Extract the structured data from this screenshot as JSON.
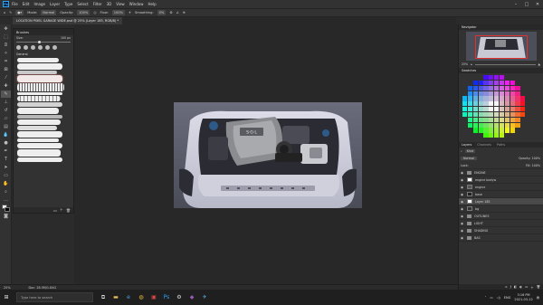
{
  "app": {
    "logo": "Ps",
    "menu": [
      "File",
      "Edit",
      "Image",
      "Layer",
      "Type",
      "Select",
      "Filter",
      "3D",
      "View",
      "Window",
      "Help"
    ],
    "window_controls": [
      "minimize-icon",
      "maximize-icon",
      "close-icon"
    ]
  },
  "options_bar": {
    "mode_label": "Mode:",
    "mode_value": "Normal",
    "opacity_label": "Opacity:",
    "opacity_value": "100%",
    "flow_label": "Flow:",
    "flow_value": "100%",
    "smoothing_label": "Smoothing:",
    "smoothing_value": "0%"
  },
  "document": {
    "tab_title": "LOCATION PIXEL GARAGE WIDE.psd @ 25% (Layer 185, RGB/8) *"
  },
  "tools": [
    "move",
    "marquee",
    "lasso",
    "quick-select",
    "crop",
    "frame",
    "eyedropper",
    "heal",
    "brush",
    "stamp",
    "history",
    "eraser",
    "gradient",
    "blur",
    "dodge",
    "pen",
    "type",
    "path-select",
    "rectangle",
    "hand",
    "zoom",
    "more",
    "color",
    "mask"
  ],
  "brushes_panel": {
    "title": "Brushes",
    "size_label": "Size:",
    "size_value": "100 px",
    "group_label": "General"
  },
  "status": {
    "zoom": "25%",
    "doc_info": "Doc: 28.5M/1.84G"
  },
  "navigator": {
    "title": "Navigator",
    "zoom": "25%"
  },
  "swatches": {
    "title": "Swatches"
  },
  "layers_panel": {
    "tabs": [
      "Layers",
      "Channels",
      "Paths"
    ],
    "kind_label": "Kind",
    "blend_mode": "Normal",
    "opacity_label": "Opacity:",
    "opacity_value": "100%",
    "lock_label": "Lock:",
    "fill_label": "Fill:",
    "fill_value": "100%",
    "layers": [
      {
        "name": "ENGINE",
        "type": "folder"
      },
      {
        "name": "engine bodyw",
        "type": "layer"
      },
      {
        "name": "engine",
        "type": "layer"
      },
      {
        "name": "base",
        "type": "layer"
      },
      {
        "name": "Layer 185",
        "type": "layer",
        "selected": true
      },
      {
        "name": "bg",
        "type": "layer"
      },
      {
        "name": "OUTLINES",
        "type": "folder"
      },
      {
        "name": "LIGHT",
        "type": "folder"
      },
      {
        "name": "SHADING",
        "type": "folder"
      },
      {
        "name": "BAS",
        "type": "folder"
      }
    ]
  },
  "taskbar": {
    "search_placeholder": "Type here to search",
    "time": "3:16 PM",
    "date": "2021-03-12",
    "lang": "ENG"
  },
  "colors": {
    "accent": "#2fa3f7",
    "selection_frame": "#e03030"
  }
}
